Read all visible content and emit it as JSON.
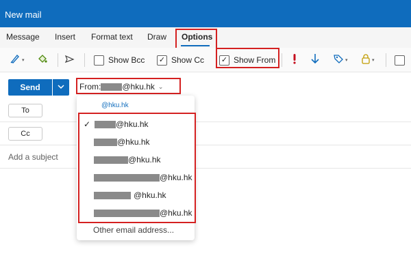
{
  "window": {
    "title": "New mail"
  },
  "tabs": [
    {
      "label": "Message",
      "active": false
    },
    {
      "label": "Insert",
      "active": false
    },
    {
      "label": "Format text",
      "active": false
    },
    {
      "label": "Draw",
      "active": false
    },
    {
      "label": "Options",
      "active": true
    }
  ],
  "ribbon": {
    "show_bcc": {
      "label": "Show Bcc",
      "checked": false
    },
    "show_cc": {
      "label": "Show Cc",
      "checked": true
    },
    "show_from": {
      "label": "Show From",
      "checked": true
    }
  },
  "compose": {
    "send_label": "Send",
    "from_prefix": "From:",
    "from_domain": "@hku.hk",
    "to_label": "To",
    "cc_label": "Cc",
    "subject_placeholder": "Add a subject"
  },
  "from_menu": {
    "header": "@hku.hk",
    "items": [
      {
        "suffix": "@hku.hk",
        "selected": true
      },
      {
        "suffix": "@hku.hk",
        "selected": false
      },
      {
        "suffix": "@hku.hk",
        "selected": false
      },
      {
        "suffix": "@hku.hk",
        "selected": false
      },
      {
        "suffix": "@hku.hk",
        "selected": false
      },
      {
        "suffix": "@hku.hk",
        "selected": false
      }
    ],
    "other_label": "Other email address..."
  },
  "colors": {
    "brand": "#0f6cbd",
    "highlight": "#d42020"
  }
}
